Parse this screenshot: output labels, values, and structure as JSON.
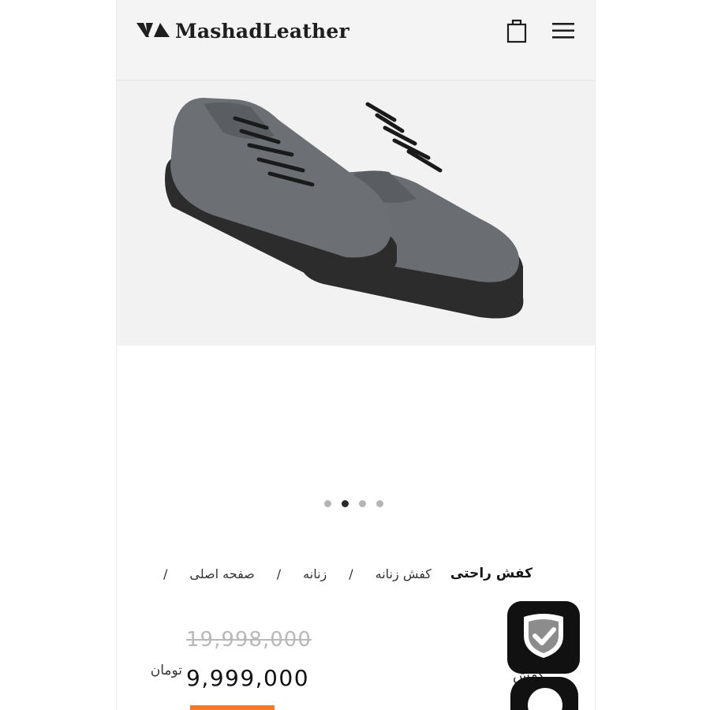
{
  "header": {
    "brand": "MashadLeather",
    "icons": {
      "cart": "shopping-bag-icon",
      "menu": "hamburger-menu-icon"
    }
  },
  "gallery": {
    "image": "gray-leather-sneakers",
    "slide_count": 4,
    "active_slide": 2
  },
  "breadcrumb": {
    "items": [
      "صفحه اصلی",
      "زنانه",
      "کفش زنانه"
    ],
    "current": "کفش راحتی",
    "separator": "/"
  },
  "price": {
    "old": "19,998,000",
    "current": "9,999,000",
    "currency": "تومان"
  },
  "floating": {
    "badge_icon": "checkmark-shield-icon",
    "side_label": "کفش"
  },
  "colors": {
    "accent": "#f07a2c",
    "header_bg": "#f4f4f4",
    "dark": "#111111"
  }
}
